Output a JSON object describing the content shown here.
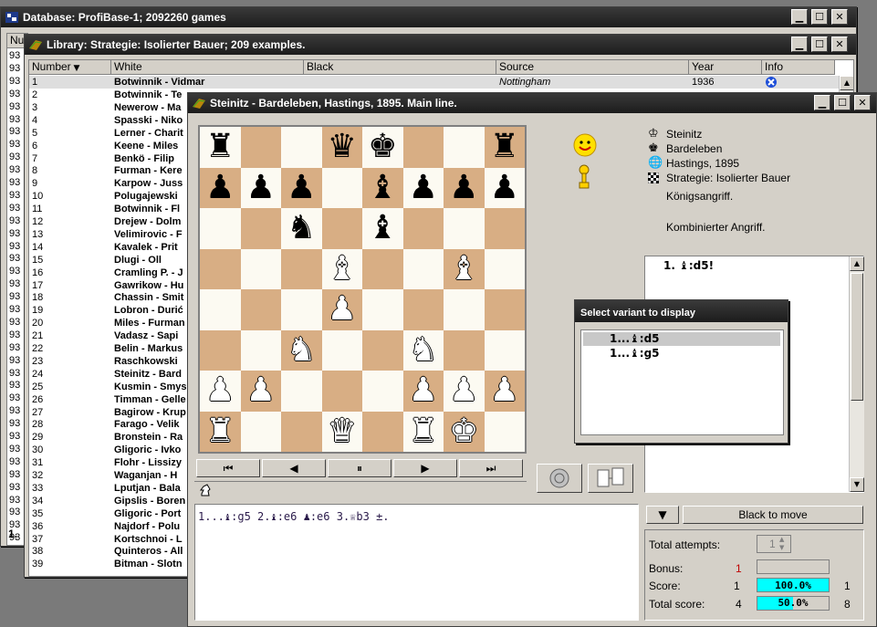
{
  "db_window": {
    "title": "Database: ProfiBase-1; 2092260 games",
    "header_stub": "Nu",
    "row_prefix": "93",
    "status_stub": "1."
  },
  "lib_window": {
    "title": "Library: Strategie: Isolierter Bauer; 209 examples.",
    "columns": [
      "Number",
      "White",
      "Black",
      "Source",
      "Year",
      "Info"
    ],
    "first_row": {
      "number": "1",
      "white": "Botwinnik - Vidmar",
      "source": "Nottingham",
      "year": "1936"
    },
    "rows": [
      {
        "n": "2",
        "w": "Botwinnik - Te"
      },
      {
        "n": "3",
        "w": "Newerow - Ma"
      },
      {
        "n": "4",
        "w": "Spasski - Niko"
      },
      {
        "n": "5",
        "w": "Lerner - Charit"
      },
      {
        "n": "6",
        "w": "Keene - Miles"
      },
      {
        "n": "7",
        "w": "Benkö - Filip"
      },
      {
        "n": "8",
        "w": "Furman - Kere"
      },
      {
        "n": "9",
        "w": "Karpow - Juss"
      },
      {
        "n": "10",
        "w": "Polugajewski"
      },
      {
        "n": "11",
        "w": "Botwinnik - Fl"
      },
      {
        "n": "12",
        "w": "Drejew - Dolm"
      },
      {
        "n": "13",
        "w": "Velimirovic - F"
      },
      {
        "n": "14",
        "w": "Kavalek - Prit"
      },
      {
        "n": "15",
        "w": "Dlugi - Oll"
      },
      {
        "n": "16",
        "w": "Cramling P. - J"
      },
      {
        "n": "17",
        "w": "Gawrikow - Hu"
      },
      {
        "n": "18",
        "w": "Chassin - Smit"
      },
      {
        "n": "19",
        "w": "Lobron - Durić"
      },
      {
        "n": "20",
        "w": "Miles - Furman"
      },
      {
        "n": "21",
        "w": "Vadasz - Sapi"
      },
      {
        "n": "22",
        "w": "Belin - Markus"
      },
      {
        "n": "23",
        "w": "Raschkowski"
      },
      {
        "n": "24",
        "w": "Steinitz - Bard"
      },
      {
        "n": "25",
        "w": "Kusmin - Smys"
      },
      {
        "n": "26",
        "w": "Timman - Gelle"
      },
      {
        "n": "27",
        "w": "Bagirow - Krup"
      },
      {
        "n": "28",
        "w": "Farago - Velik"
      },
      {
        "n": "29",
        "w": "Bronstein - Ra"
      },
      {
        "n": "30",
        "w": "Gligoric - Ivko"
      },
      {
        "n": "31",
        "w": "Flohr - Lissizy"
      },
      {
        "n": "32",
        "w": "Waganjan - H"
      },
      {
        "n": "33",
        "w": "Lputjan - Bala"
      },
      {
        "n": "34",
        "w": "Gipslis - Boren"
      },
      {
        "n": "35",
        "w": "Gligoric - Port"
      },
      {
        "n": "36",
        "w": "Najdorf - Polu"
      },
      {
        "n": "37",
        "w": "Kortschnoi - L"
      },
      {
        "n": "38",
        "w": "Quinteros - All"
      },
      {
        "n": "39",
        "w": "Bitman - Slotn"
      }
    ]
  },
  "game_window": {
    "title": "Steinitz - Bardeleben, Hastings, 1895. Main line.",
    "info": {
      "white": "Steinitz",
      "black": "Bardeleben",
      "event": "Hastings, 1895",
      "theme": "Strategie: Isolierter Bauer",
      "note1": "Königsangriff.",
      "note2": "Kombinierter Angriff."
    },
    "moves_header": "1. ♝:d5!",
    "analysis_line": "1...♝:g5 2.♝:e6 ♟:e6 3.♕b3 ±.",
    "variant_dialog": {
      "title": "Select variant to display",
      "items": [
        "1...♝:d5",
        "1...♝:g5"
      ]
    },
    "side_to_move": "Black to move",
    "stats": {
      "total_attempts_label": "Total attempts:",
      "total_attempts_value": "1",
      "bonus_label": "Bonus:",
      "bonus_value": "1",
      "score_label": "Score:",
      "score_left": "1",
      "score_pct": "100.0%",
      "score_right": "1",
      "total_score_label": "Total score:",
      "total_left": "4",
      "total_pct": "50.0%",
      "total_right": "8"
    },
    "nav": [
      "⏮",
      "◀",
      "⏸",
      "▶",
      "⏭"
    ],
    "accent_bar_color": "#00ffff",
    "board": [
      [
        "r",
        "",
        "",
        "q",
        "k",
        "",
        "",
        "r"
      ],
      [
        "p",
        "p",
        "p",
        "",
        "b",
        "p",
        "p",
        "p"
      ],
      [
        "",
        "",
        "n",
        "",
        "b",
        "",
        "",
        ""
      ],
      [
        "",
        "",
        "",
        "B",
        "",
        "",
        "B",
        ""
      ],
      [
        "",
        "",
        "",
        "P",
        "",
        "",
        "",
        ""
      ],
      [
        "",
        "",
        "N",
        "",
        "",
        "N",
        "",
        ""
      ],
      [
        "P",
        "P",
        "",
        "",
        "",
        "P",
        "P",
        "P"
      ],
      [
        "R",
        "",
        "",
        "Q",
        "",
        "R",
        "K",
        ""
      ]
    ]
  }
}
